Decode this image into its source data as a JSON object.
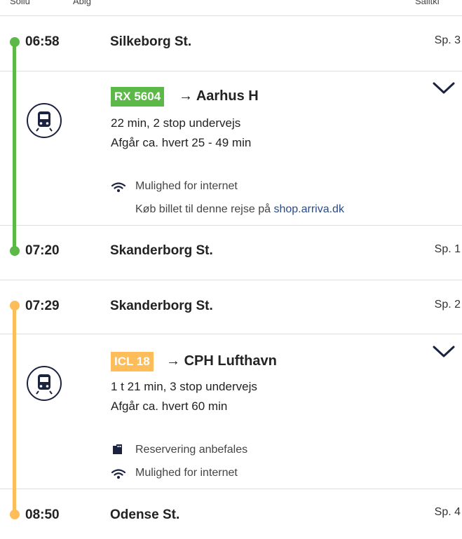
{
  "header_cutoff": {
    "left1": "Sollu",
    "left2": "Ablg",
    "right": "Salitki"
  },
  "colors": {
    "leg1_line": "#5cb947",
    "leg2_line": "#fdbd5b",
    "rx_badge": "#5cb947",
    "icl_badge": "#fdbd5b",
    "link": "#2a4a8a"
  },
  "legs": [
    {
      "dep_time": "06:58",
      "dep_station": "Silkeborg St.",
      "dep_track": "Sp. 3",
      "badge": "RX 5604",
      "arrow": "→",
      "destination": "Aarhus H",
      "duration": "22 min, 2 stop undervejs",
      "frequency": "Afgår ca. hvert 25 - 49 min",
      "features": [
        {
          "icon": "wifi-icon",
          "text": "Mulighed for internet"
        }
      ],
      "ticket_prefix": "Køb billet til denne rejse på",
      "ticket_link": "shop.arriva.dk",
      "arr_time": "07:20",
      "arr_station": "Skanderborg St.",
      "arr_track": "Sp. 1"
    },
    {
      "dep_time": "07:29",
      "dep_station": "Skanderborg St.",
      "dep_track": "Sp. 2",
      "badge": "ICL 18",
      "arrow": "→",
      "destination": "CPH Lufthavn",
      "duration": "1 t 21 min, 3 stop undervejs",
      "frequency": "Afgår ca. hvert 60 min",
      "features": [
        {
          "icon": "reservation-icon",
          "text": "Reservering anbefales"
        },
        {
          "icon": "wifi-icon",
          "text": "Mulighed for internet"
        }
      ],
      "arr_time": "08:50",
      "arr_station": "Odense St.",
      "arr_track": "Sp. 4"
    }
  ]
}
